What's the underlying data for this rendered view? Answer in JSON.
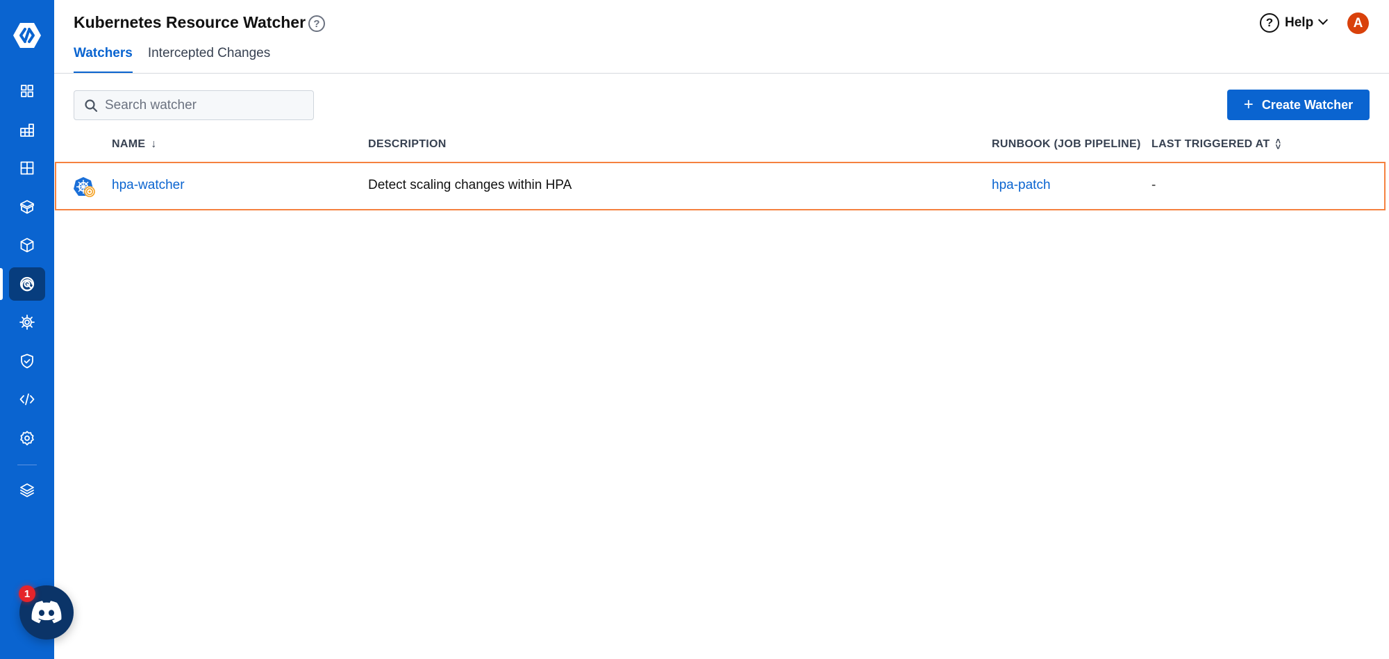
{
  "app": {
    "title": "Kubernetes Resource Watcher",
    "title_help_icon": "question-circle-icon"
  },
  "header": {
    "help_label": "Help",
    "help_icon": "question-circle-icon",
    "avatar_initial": "A",
    "avatar_color": "#d9410b"
  },
  "sidebar": {
    "logo_icon": "brand-logo-icon",
    "items": [
      {
        "name": "dashboard",
        "icon": "grid-icon",
        "active": false
      },
      {
        "name": "infrastructure",
        "icon": "stacked-grid-icon",
        "active": false
      },
      {
        "name": "environments",
        "icon": "table-grid-icon",
        "active": false
      },
      {
        "name": "releases",
        "icon": "open-box-icon",
        "active": false
      },
      {
        "name": "components",
        "icon": "cube-icon",
        "active": false
      },
      {
        "name": "resource-watcher",
        "icon": "radar-icon",
        "active": true
      },
      {
        "name": "chaos",
        "icon": "gear-sun-icon",
        "active": false
      },
      {
        "name": "security",
        "icon": "shield-check-icon",
        "active": false
      },
      {
        "name": "code",
        "icon": "code-icon",
        "active": false
      },
      {
        "name": "settings",
        "icon": "gear-icon",
        "active": false
      },
      {
        "name": "layers",
        "icon": "layers-icon",
        "active": false
      }
    ],
    "discord_badge_count": "1"
  },
  "tabs": [
    {
      "label": "Watchers",
      "active": true
    },
    {
      "label": "Intercepted Changes",
      "active": false
    }
  ],
  "toolbar": {
    "search_placeholder": "Search watcher",
    "search_value": "",
    "create_label": "Create Watcher"
  },
  "table": {
    "columns": [
      {
        "label": "NAME",
        "sort": "desc-arrow"
      },
      {
        "label": "DESCRIPTION",
        "sort": ""
      },
      {
        "label": "RUNBOOK (JOB PIPELINE)",
        "sort": ""
      },
      {
        "label": "LAST TRIGGERED AT",
        "sort": "sortable"
      }
    ],
    "rows": [
      {
        "icon": "kubernetes-watcher-icon",
        "name": "hpa-watcher",
        "description": "Detect scaling changes within HPA",
        "runbook": "hpa-patch",
        "last_triggered": "-"
      }
    ]
  },
  "colors": {
    "brand": "#0a64d0",
    "sidebar_active": "#073d7e",
    "highlight_border": "#f5813f",
    "discord": "#0b3468",
    "badge": "#e5242a"
  }
}
